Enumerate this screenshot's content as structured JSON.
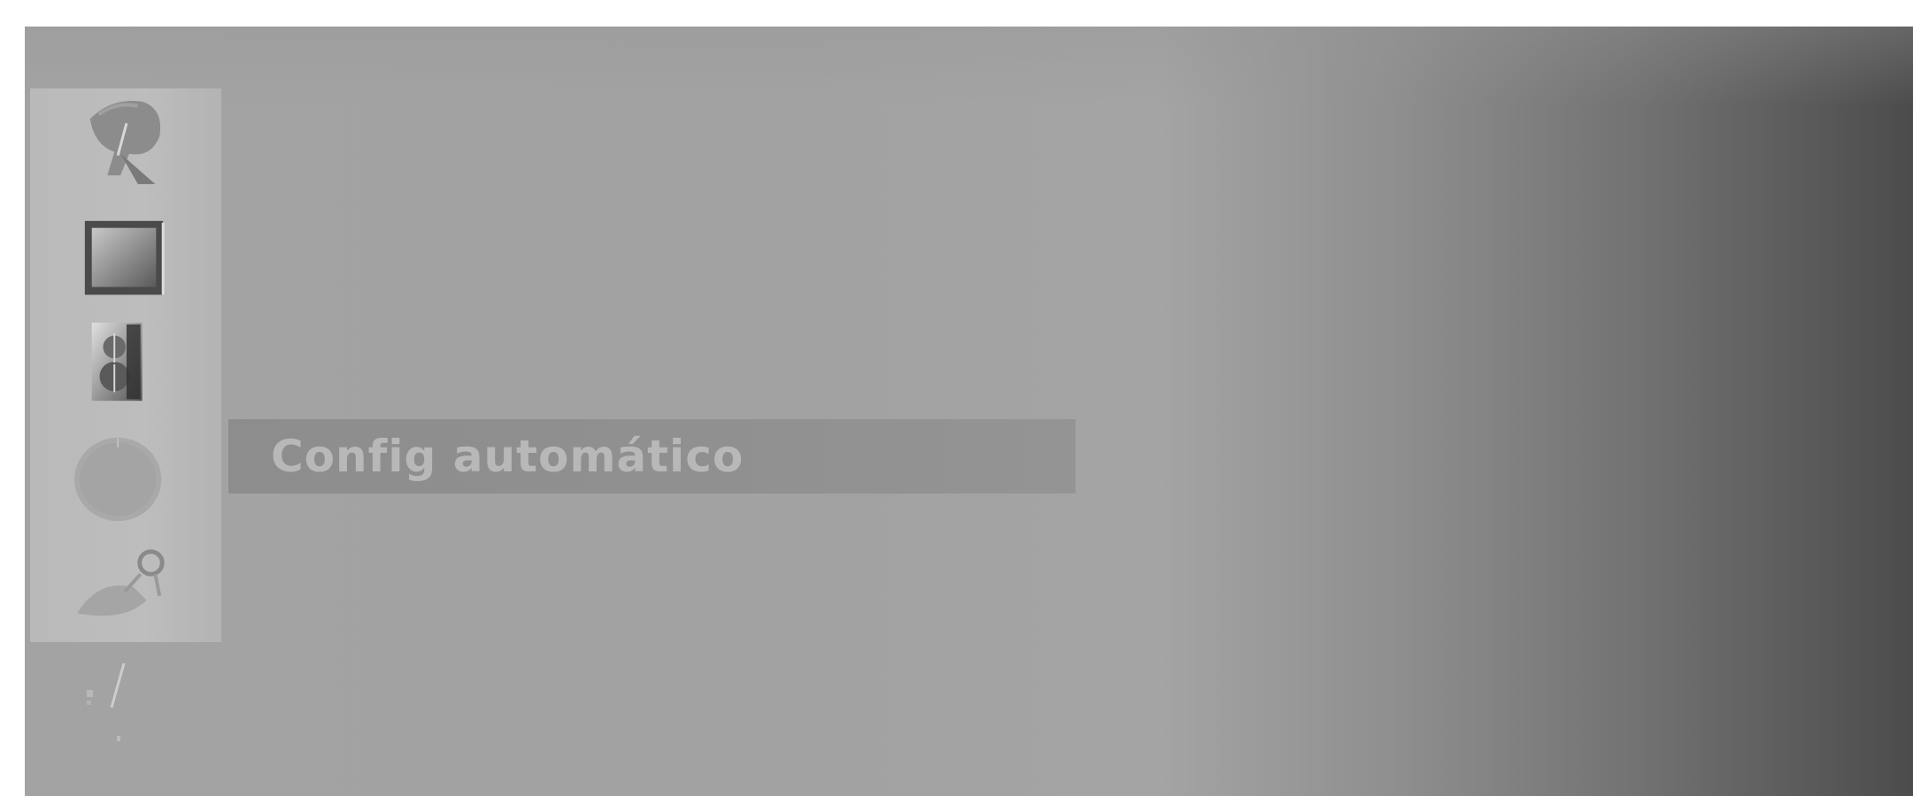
{
  "menu": {
    "icons": [
      "satellite-dish-icon",
      "picture-monitor-icon",
      "speaker-icon",
      "clock-icon",
      "settings-satellite-icon",
      "lock-icon"
    ],
    "highlighted_item": {
      "label": "Config automático"
    }
  },
  "colors": {
    "panel_grey": "#a3a3a3",
    "panel_dark_edge": "#4c4c4c",
    "icon_strip": "#bbbbbb",
    "highlight_bar": "#8f8f8f",
    "highlight_text": "#b8b8b8"
  }
}
